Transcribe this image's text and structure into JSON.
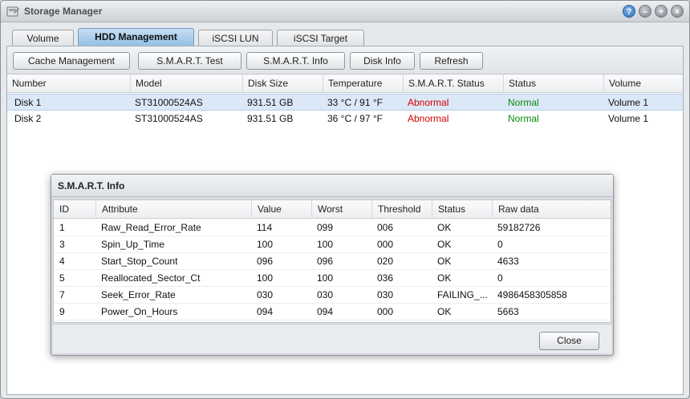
{
  "window": {
    "title": "Storage Manager",
    "controls": {
      "help": "?",
      "minimize": "–",
      "maximize": "+",
      "close": "×"
    }
  },
  "tabs": [
    {
      "label": "Volume",
      "active": false
    },
    {
      "label": "HDD Management",
      "active": true
    },
    {
      "label": "iSCSI LUN",
      "active": false
    },
    {
      "label": "iSCSI Target",
      "active": false
    }
  ],
  "toolbar": {
    "cache_management": "Cache Management",
    "smart_test": "S.M.A.R.T. Test",
    "smart_info": "S.M.A.R.T. Info",
    "disk_info": "Disk Info",
    "refresh": "Refresh"
  },
  "disk_table": {
    "columns": [
      "Number",
      "Model",
      "Disk Size",
      "Temperature",
      "S.M.A.R.T. Status",
      "Status",
      "Volume"
    ],
    "rows": [
      {
        "number": "Disk 1",
        "model": "ST31000524AS",
        "size": "931.51 GB",
        "temperature": "33 °C / 91 °F",
        "smart_status": "Abnormal",
        "status": "Normal",
        "volume": "Volume 1",
        "selected": true
      },
      {
        "number": "Disk 2",
        "model": "ST31000524AS",
        "size": "931.51 GB",
        "temperature": "36 °C / 97 °F",
        "smart_status": "Abnormal",
        "status": "Normal",
        "volume": "Volume 1",
        "selected": false
      }
    ]
  },
  "smart_dialog": {
    "title": "S.M.A.R.T. Info",
    "columns": [
      "ID",
      "Attribute",
      "Value",
      "Worst",
      "Threshold",
      "Status",
      "Raw data"
    ],
    "rows": [
      {
        "id": "1",
        "attribute": "Raw_Read_Error_Rate",
        "value": "114",
        "worst": "099",
        "threshold": "006",
        "status": "OK",
        "raw": "59182726"
      },
      {
        "id": "3",
        "attribute": "Spin_Up_Time",
        "value": "100",
        "worst": "100",
        "threshold": "000",
        "status": "OK",
        "raw": "0"
      },
      {
        "id": "4",
        "attribute": "Start_Stop_Count",
        "value": "096",
        "worst": "096",
        "threshold": "020",
        "status": "OK",
        "raw": "4633"
      },
      {
        "id": "5",
        "attribute": "Reallocated_Sector_Ct",
        "value": "100",
        "worst": "100",
        "threshold": "036",
        "status": "OK",
        "raw": "0"
      },
      {
        "id": "7",
        "attribute": "Seek_Error_Rate",
        "value": "030",
        "worst": "030",
        "threshold": "030",
        "status": "FAILING_...",
        "raw": "4986458305858"
      },
      {
        "id": "9",
        "attribute": "Power_On_Hours",
        "value": "094",
        "worst": "094",
        "threshold": "000",
        "status": "OK",
        "raw": "5663"
      }
    ],
    "close_label": "Close"
  },
  "colors": {
    "abnormal": "#d40000",
    "normal": "#0a8a0a",
    "failing": "#d40000",
    "active_tab": "#8fbde3",
    "selected_row": "#dbe8f7"
  }
}
